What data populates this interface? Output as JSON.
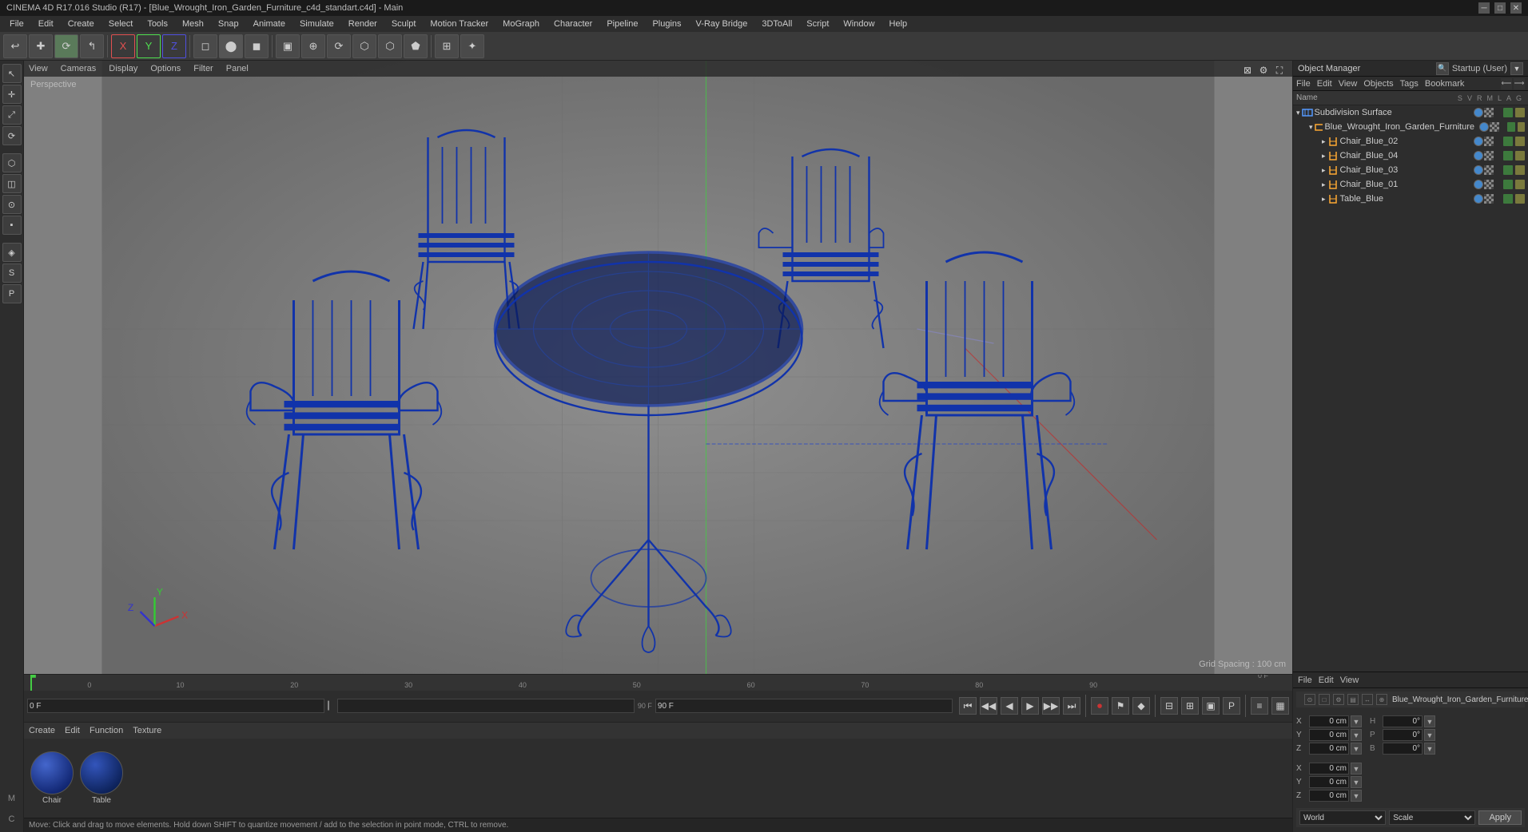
{
  "titleBar": {
    "title": "CINEMA 4D R17.016 Studio (R17) - [Blue_Wrought_Iron_Garden_Furniture_c4d_standart.c4d] - Main",
    "minimize": "─",
    "maximize": "□",
    "close": "✕"
  },
  "menuBar": {
    "items": [
      "File",
      "Edit",
      "Create",
      "Select",
      "Tools",
      "Mesh",
      "Snap",
      "Animate",
      "Simulate",
      "Render",
      "Sculpt",
      "Motion Tracker",
      "MoGraph",
      "Character",
      "Pipeline",
      "Plugins",
      "V-Ray Bridge",
      "3DToAll",
      "Script",
      "Window",
      "Help"
    ]
  },
  "toolbar": {
    "icons": [
      "↩",
      "✚",
      "⟳",
      "↰",
      "X",
      "Y",
      "Z",
      "◻",
      "⬤",
      "◼",
      "▣",
      "⊕",
      "⟳",
      "⬡",
      "⬡",
      "⬟",
      "⊞",
      "✦"
    ]
  },
  "viewport": {
    "tabs": [
      "View",
      "Cameras",
      "Display",
      "Options",
      "Filter",
      "Panel"
    ],
    "perspectiveLabel": "Perspective",
    "gridSpacing": "Grid Spacing : 100 cm"
  },
  "objectManager": {
    "header": {
      "title": "Object Manager",
      "layoutLabel": "Startup (User)"
    },
    "menuItems": [
      "File",
      "Edit",
      "View",
      "Objects",
      "Tags",
      "Bookmark"
    ],
    "objects": [
      {
        "id": "subdivision",
        "name": "Subdivision Surface",
        "level": 0,
        "icon": "▾",
        "selected": false,
        "hasChildren": true
      },
      {
        "id": "furniture_group",
        "name": "Blue_Wrought_Iron_Garden_Furniture",
        "level": 1,
        "icon": "▾",
        "selected": false,
        "hasChildren": true
      },
      {
        "id": "chair_blue_02",
        "name": "Chair_Blue_02",
        "level": 2,
        "icon": "▸",
        "selected": false
      },
      {
        "id": "chair_blue_04",
        "name": "Chair_Blue_04",
        "level": 2,
        "icon": "▸",
        "selected": false
      },
      {
        "id": "chair_blue_03",
        "name": "Chair_Blue_03",
        "level": 2,
        "icon": "▸",
        "selected": false
      },
      {
        "id": "chair_blue_01",
        "name": "Chair_Blue_01",
        "level": 2,
        "icon": "▸",
        "selected": false
      },
      {
        "id": "table_blue",
        "name": "Table_Blue",
        "level": 2,
        "icon": "▸",
        "selected": false
      }
    ]
  },
  "coordPanel": {
    "menuItems": [
      "File",
      "Edit",
      "View"
    ],
    "selectedObject": "Blue_Wrought_Iron_Garden_Furniture",
    "columns": {
      "S": "S",
      "V": "V",
      "R": "R",
      "M": "M",
      "L": "L",
      "A": "A",
      "G": "G"
    },
    "coordinates": {
      "X": "0 cm",
      "Y": "0 cm",
      "Z": "0 cm",
      "XScale": "0 cm",
      "YScale": "0 cm",
      "ZScale": "0 cm",
      "H": "0°",
      "P": "0°",
      "B": "0°"
    },
    "worldLabel": "World",
    "scaleLabel": "Scale",
    "applyLabel": "Apply"
  },
  "materialEditor": {
    "tabs": [
      "Create",
      "Edit",
      "Function",
      "Texture"
    ],
    "materials": [
      {
        "name": "Chair",
        "type": "blue_metal"
      },
      {
        "name": "Table",
        "type": "blue_metal"
      }
    ]
  },
  "timeline": {
    "frameStart": "0 F",
    "frameEnd": "90 F",
    "currentFrame": "0 F",
    "scrubberValue": "90 F",
    "ticks": [
      0,
      10,
      20,
      30,
      40,
      50,
      60,
      70,
      80,
      90
    ]
  },
  "statusBar": {
    "message": "Move: Click and drag to move elements. Hold down SHIFT to quantize movement / add to the selection in point mode, CTRL to remove."
  }
}
